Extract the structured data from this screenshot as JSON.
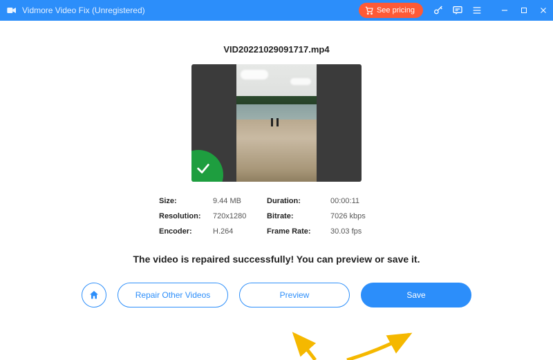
{
  "titlebar": {
    "app_name": "Vidmore Video Fix (Unregistered)",
    "pricing_label": "See pricing"
  },
  "file": {
    "name": "VID20221029091717.mp4"
  },
  "info": {
    "size_label": "Size:",
    "size_value": "9.44 MB",
    "duration_label": "Duration:",
    "duration_value": "00:00:11",
    "resolution_label": "Resolution:",
    "resolution_value": "720x1280",
    "bitrate_label": "Bitrate:",
    "bitrate_value": "7026 kbps",
    "encoder_label": "Encoder:",
    "encoder_value": "H.264",
    "framerate_label": "Frame Rate:",
    "framerate_value": "30.03 fps"
  },
  "message": "The video is repaired successfully! You can preview or save it.",
  "buttons": {
    "repair_other": "Repair Other Videos",
    "preview": "Preview",
    "save": "Save"
  }
}
